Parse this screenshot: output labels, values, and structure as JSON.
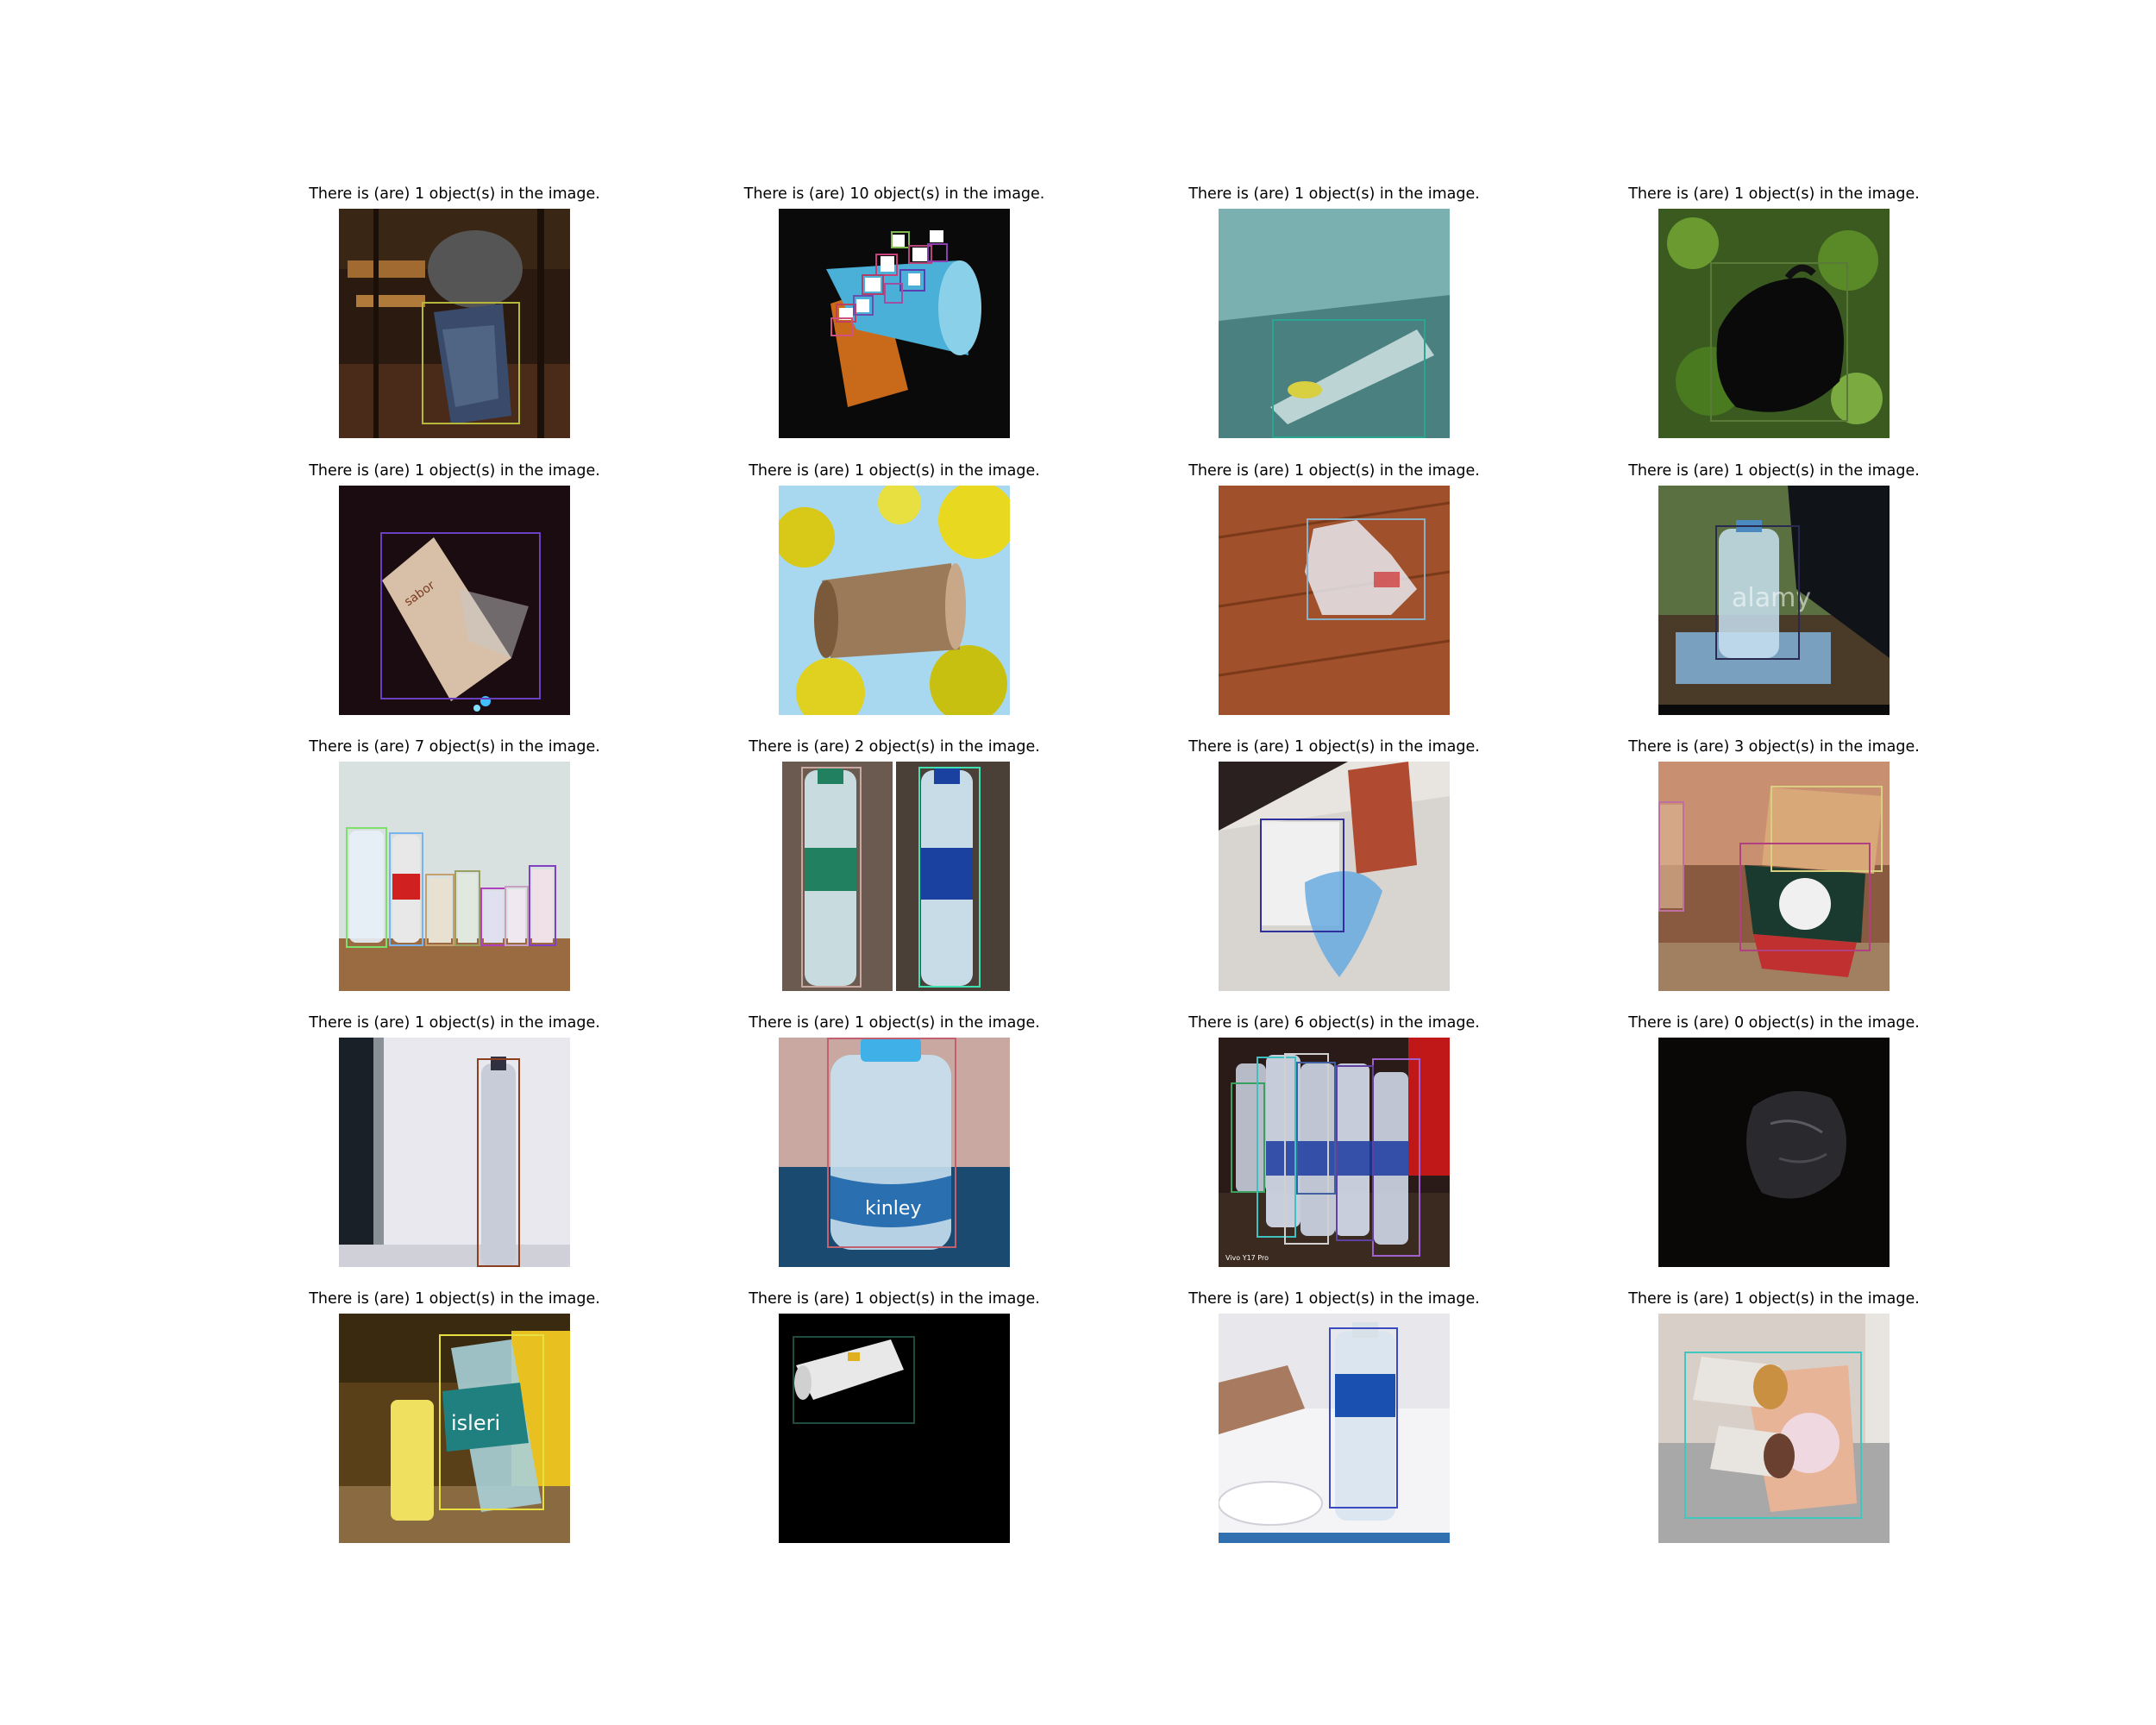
{
  "panels": [
    {
      "caption": "There is (are) 1 object(s) in the image.",
      "scene": "dark-room-trash-bag",
      "boxes": [
        {
          "color": "#b5b83a"
        }
      ]
    },
    {
      "caption": "There is (are) 10 object(s) in the image.",
      "scene": "blue-cup-spilling-pieces",
      "boxes": [
        {
          "color": "#7fb84c"
        },
        {
          "color": "#b4467a"
        },
        {
          "color": "#8c3fb0"
        },
        {
          "color": "#c8407a"
        },
        {
          "color": "#5a3fb0"
        },
        {
          "color": "#b0406a"
        },
        {
          "color": "#a04fa0"
        },
        {
          "color": "#c04060"
        },
        {
          "color": "#6a4fb0"
        },
        {
          "color": "#d05080"
        }
      ]
    },
    {
      "caption": "There is (are) 1 object(s) in the image.",
      "scene": "crushed-bottle-teal-corner",
      "boxes": [
        {
          "color": "#2aa58f"
        }
      ]
    },
    {
      "caption": "There is (are) 1 object(s) in the image.",
      "scene": "black-bag-on-moss",
      "boxes": [
        {
          "color": "#5a7a3a"
        }
      ]
    },
    {
      "caption": "There is (are) 1 object(s) in the image.",
      "scene": "printed-paper-cup-night",
      "boxes": [
        {
          "color": "#6a3fc0"
        }
      ]
    },
    {
      "caption": "There is (are) 1 object(s) in the image.",
      "scene": "kraft-cup-yellow-tree",
      "boxes": []
    },
    {
      "caption": "There is (are) 1 object(s) in the image.",
      "scene": "plastic-bag-wood-floor",
      "boxes": [
        {
          "color": "#8ab0c8"
        }
      ]
    },
    {
      "caption": "There is (are) 1 object(s) in the image.",
      "scene": "water-bottle-on-books",
      "boxes": [
        {
          "color": "#2a2a50"
        }
      ],
      "watermark": "alamy"
    },
    {
      "caption": "There is (are) 7 object(s) in the image.",
      "scene": "row-of-bottles",
      "boxes": [
        {
          "color": "#7de06a"
        },
        {
          "color": "#7ab4f0"
        },
        {
          "color": "#c8a070"
        },
        {
          "color": "#9aa060"
        },
        {
          "color": "#b040c0"
        },
        {
          "color": "#c8a0c0"
        },
        {
          "color": "#8040c0"
        }
      ]
    },
    {
      "caption": "There is (are) 2 object(s) in the image.",
      "scene": "two-water-bottles",
      "boxes": [
        {
          "color": "#c8a8a0"
        },
        {
          "color": "#40e0b0"
        }
      ]
    },
    {
      "caption": "There is (are) 1 object(s) in the image.",
      "scene": "plastic-bags-drawer",
      "boxes": [
        {
          "color": "#30309a"
        }
      ]
    },
    {
      "caption": "There is (are) 3 object(s) in the image.",
      "scene": "stacked-coffee-cups",
      "boxes": [
        {
          "color": "#d8d080"
        },
        {
          "color": "#b04080"
        },
        {
          "color": "#c070a0"
        }
      ]
    },
    {
      "caption": "There is (are) 1 object(s) in the image.",
      "scene": "bottle-window",
      "boxes": [
        {
          "color": "#8a4020"
        }
      ]
    },
    {
      "caption": "There is (are) 1 object(s) in the image.",
      "scene": "kinley-bottle",
      "boxes": [
        {
          "color": "#c06070"
        }
      ]
    },
    {
      "caption": "There is (are) 6 object(s) in the image.",
      "scene": "aqua-bottles-group",
      "boxes": [
        {
          "color": "#3aa060"
        },
        {
          "color": "#40c0c0"
        },
        {
          "color": "#d0d0d0"
        },
        {
          "color": "#4060a0"
        },
        {
          "color": "#a060d0"
        },
        {
          "color": "#6040a0"
        }
      ]
    },
    {
      "caption": "There is (are) 0 object(s) in the image.",
      "scene": "black-bag-dark",
      "boxes": []
    },
    {
      "caption": "There is (are) 1 object(s) in the image.",
      "scene": "bisleri-bottle-shelf",
      "boxes": [
        {
          "color": "#e8e040"
        }
      ]
    },
    {
      "caption": "There is (are) 1 object(s) in the image.",
      "scene": "white-cup-black-bg",
      "boxes": [
        {
          "color": "#1f4a40"
        }
      ]
    },
    {
      "caption": "There is (are) 1 object(s) in the image.",
      "scene": "pure-life-bottle-desk",
      "boxes": [
        {
          "color": "#3a4ac0"
        }
      ]
    },
    {
      "caption": "There is (are) 1 object(s) in the image.",
      "scene": "coffee-cups-carpet",
      "boxes": [
        {
          "color": "#40c8c0"
        }
      ]
    }
  ]
}
